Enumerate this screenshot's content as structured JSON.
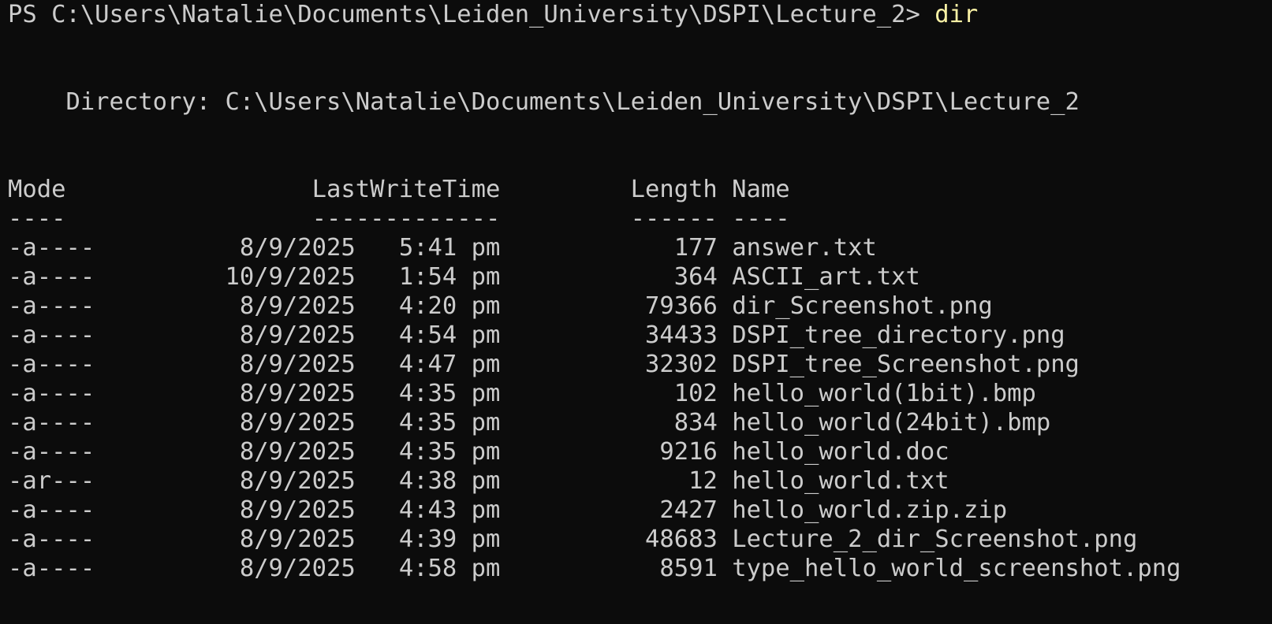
{
  "prompt": {
    "text": "PS C:\\Users\\Natalie\\Documents\\Leiden_University\\DSPI\\Lecture_2> ",
    "command": "dir"
  },
  "directory_line": "    Directory: C:\\Users\\Natalie\\Documents\\Leiden_University\\DSPI\\Lecture_2",
  "header": {
    "mode": "Mode",
    "lastwritetime": "LastWriteTime",
    "length": "Length",
    "name": "Name"
  },
  "underline": {
    "mode": "----",
    "lastwritetime": "-------------",
    "length": "------",
    "name": "----"
  },
  "colors": {
    "background": "#0c0c0c",
    "foreground": "#cccccc",
    "command": "#f9f1a5"
  },
  "files": [
    {
      "mode": "-a----",
      "date": "8/9/2025",
      "time": "5:41 pm",
      "length": "177",
      "name": "answer.txt"
    },
    {
      "mode": "-a----",
      "date": "10/9/2025",
      "time": "1:54 pm",
      "length": "364",
      "name": "ASCII_art.txt"
    },
    {
      "mode": "-a----",
      "date": "8/9/2025",
      "time": "4:20 pm",
      "length": "79366",
      "name": "dir_Screenshot.png"
    },
    {
      "mode": "-a----",
      "date": "8/9/2025",
      "time": "4:54 pm",
      "length": "34433",
      "name": "DSPI_tree_directory.png"
    },
    {
      "mode": "-a----",
      "date": "8/9/2025",
      "time": "4:47 pm",
      "length": "32302",
      "name": "DSPI_tree_Screenshot.png"
    },
    {
      "mode": "-a----",
      "date": "8/9/2025",
      "time": "4:35 pm",
      "length": "102",
      "name": "hello_world(1bit).bmp"
    },
    {
      "mode": "-a----",
      "date": "8/9/2025",
      "time": "4:35 pm",
      "length": "834",
      "name": "hello_world(24bit).bmp"
    },
    {
      "mode": "-a----",
      "date": "8/9/2025",
      "time": "4:35 pm",
      "length": "9216",
      "name": "hello_world.doc"
    },
    {
      "mode": "-ar---",
      "date": "8/9/2025",
      "time": "4:38 pm",
      "length": "12",
      "name": "hello_world.txt"
    },
    {
      "mode": "-a----",
      "date": "8/9/2025",
      "time": "4:43 pm",
      "length": "2427",
      "name": "hello_world.zip.zip"
    },
    {
      "mode": "-a----",
      "date": "8/9/2025",
      "time": "4:39 pm",
      "length": "48683",
      "name": "Lecture_2_dir_Screenshot.png"
    },
    {
      "mode": "-a----",
      "date": "8/9/2025",
      "time": "4:58 pm",
      "length": "8591",
      "name": "type_hello_world_screenshot.png"
    }
  ]
}
